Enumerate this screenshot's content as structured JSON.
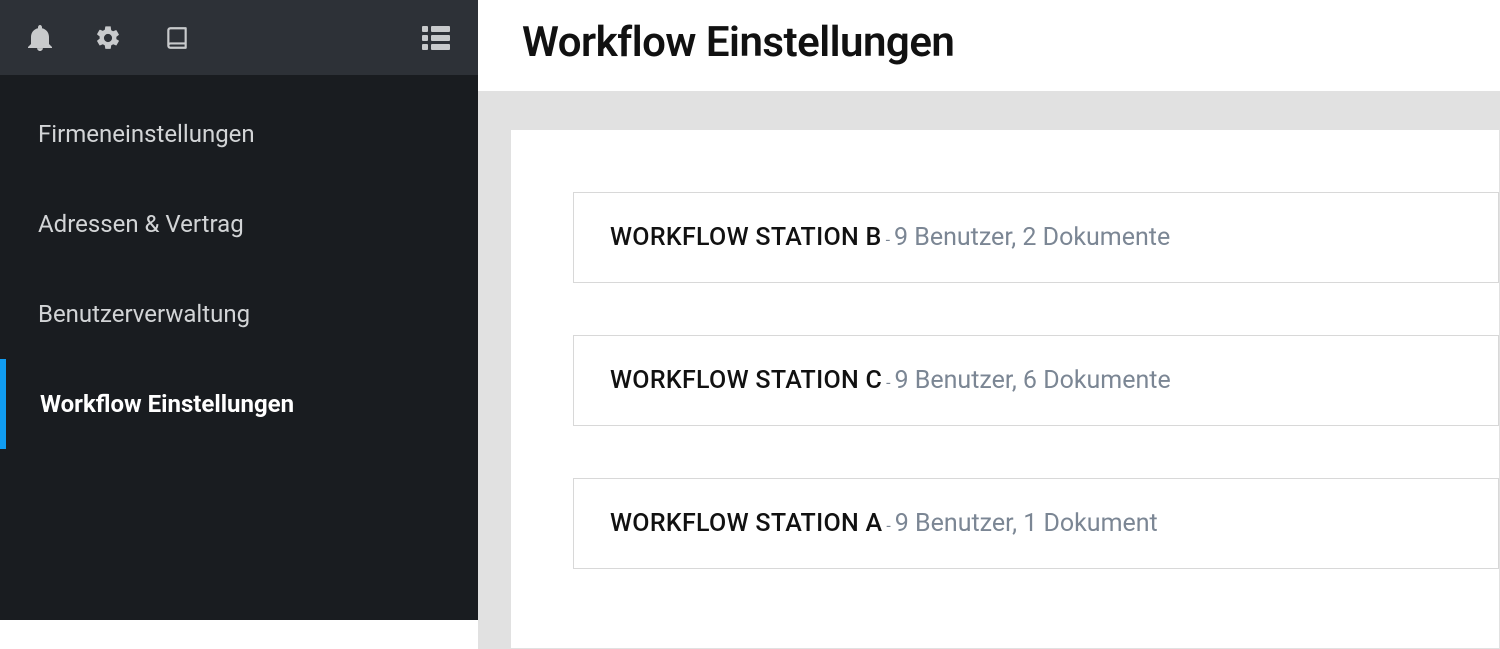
{
  "sidebar": {
    "items": [
      {
        "label": "Firmeneinstellungen"
      },
      {
        "label": "Adressen & Vertrag"
      },
      {
        "label": "Benutzerverwaltung"
      },
      {
        "label": "Workflow Einstellungen"
      }
    ],
    "active_index": 3
  },
  "page": {
    "title": "Workflow Einstellungen"
  },
  "stations": [
    {
      "name": "WORKFLOW STATION B",
      "meta": "9 Benutzer, 2 Dokumente"
    },
    {
      "name": "WORKFLOW STATION C",
      "meta": "9 Benutzer, 6 Dokumente"
    },
    {
      "name": "WORKFLOW STATION A",
      "meta": "9 Benutzer, 1 Dokument"
    }
  ],
  "separator": " - "
}
